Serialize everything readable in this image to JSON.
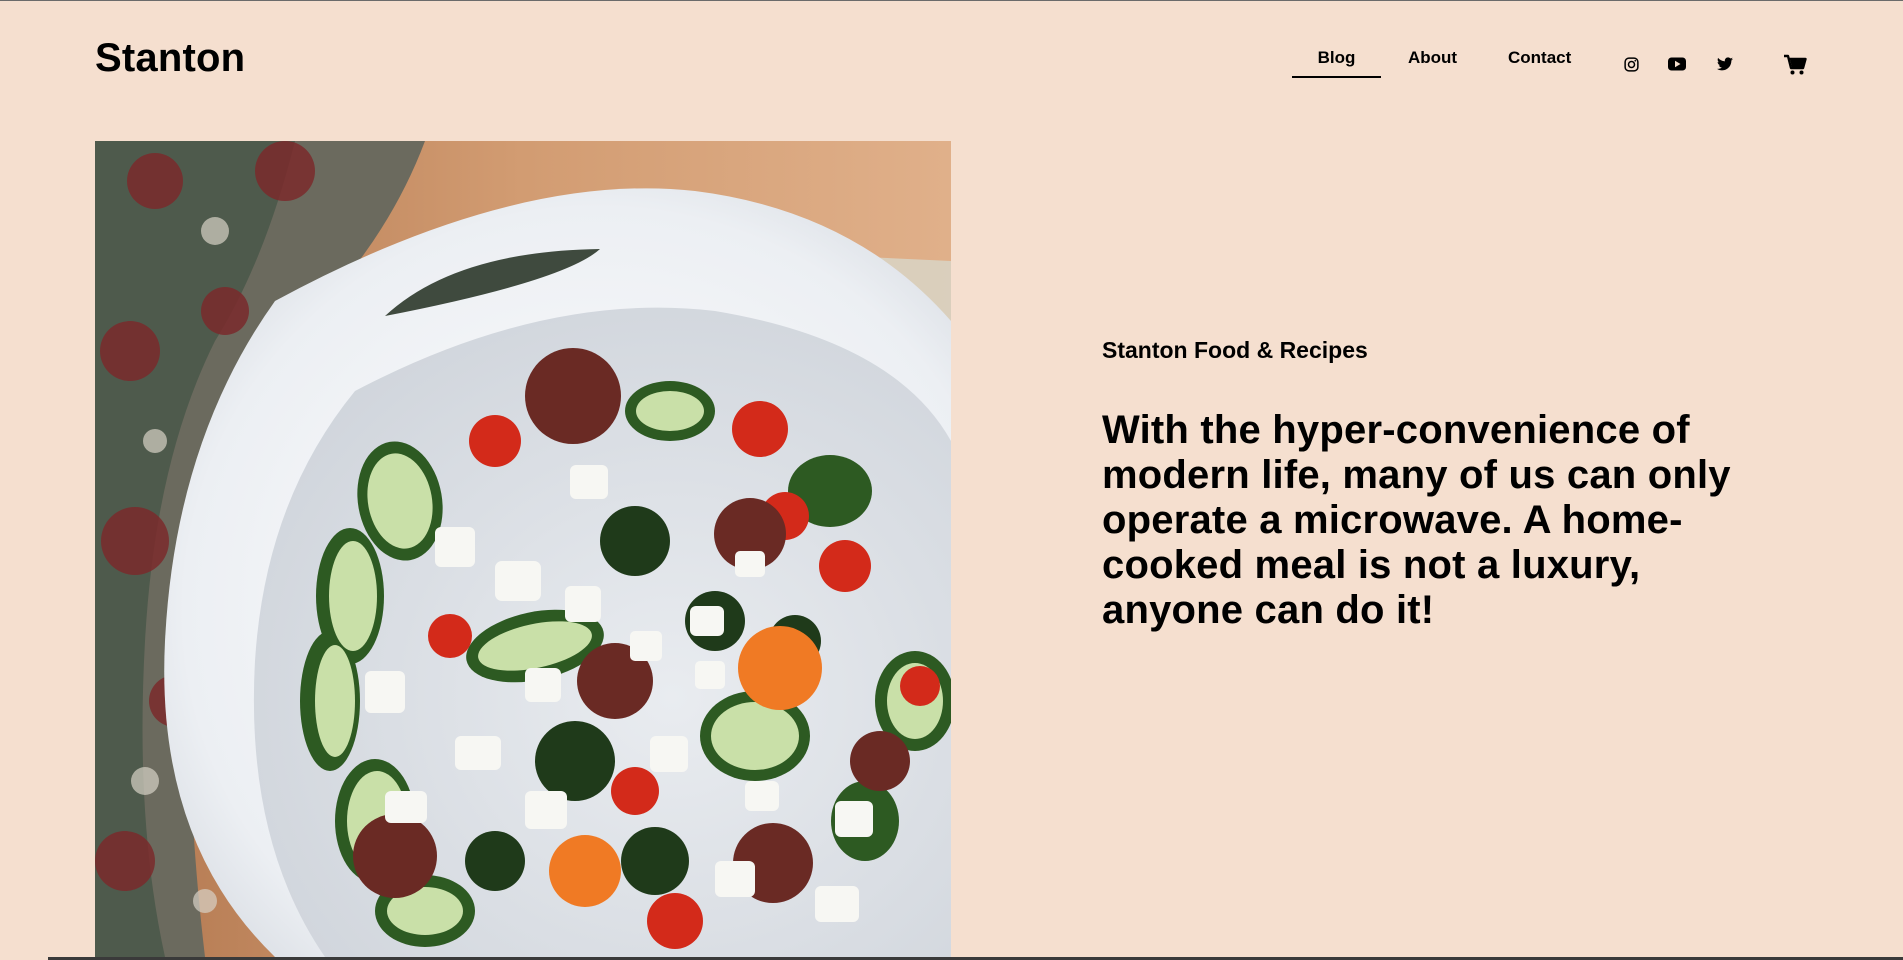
{
  "site": {
    "logo": "Stanton"
  },
  "nav": {
    "items": [
      {
        "label": "Blog",
        "active": true
      },
      {
        "label": "About",
        "active": false
      },
      {
        "label": "Contact",
        "active": false
      }
    ]
  },
  "social": {
    "icons": [
      "instagram-icon",
      "youtube-icon",
      "twitter-icon"
    ]
  },
  "cart": {
    "icon": "cart-icon"
  },
  "hero": {
    "image_subject": "salad-bowl-photo",
    "subtitle": "Stanton Food & Recipes",
    "headline": "With the hyper-convenience of modern life, many of us can only operate a microwave. A home-cooked meal is not a luxury, anyone can do it!"
  },
  "colors": {
    "background": "#f5dfcf",
    "text": "#000000"
  }
}
